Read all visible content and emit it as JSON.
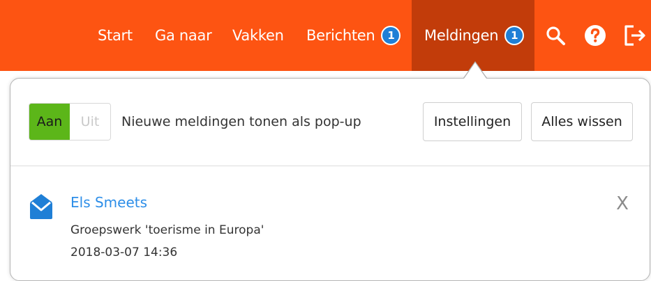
{
  "nav": {
    "items": [
      {
        "label": "Start"
      },
      {
        "label": "Ga naar"
      },
      {
        "label": "Vakken"
      },
      {
        "label": "Berichten",
        "badge": "1"
      },
      {
        "label": "Meldingen",
        "badge": "1",
        "active": true
      }
    ],
    "icons": [
      "search-icon",
      "help-icon",
      "logout-icon"
    ]
  },
  "colors": {
    "bar": "#fd5412",
    "active_tab": "#c23c0a",
    "badge": "#1f7fd6",
    "toggle_on": "#5cb619",
    "link": "#2d8ee8"
  },
  "panel": {
    "toggle": {
      "on_label": "Aan",
      "off_label": "Uit",
      "state": "on"
    },
    "toggle_text": "Nieuwe meldingen tonen als pop-up",
    "settings_label": "Instellingen",
    "clear_label": "Alles wissen"
  },
  "notification": {
    "icon": "envelope-icon",
    "sender": "Els Smeets",
    "subject": "Groepswerk 'toerisme in Europa'",
    "timestamp": "2018-03-07 14:36",
    "close_label": "X"
  }
}
